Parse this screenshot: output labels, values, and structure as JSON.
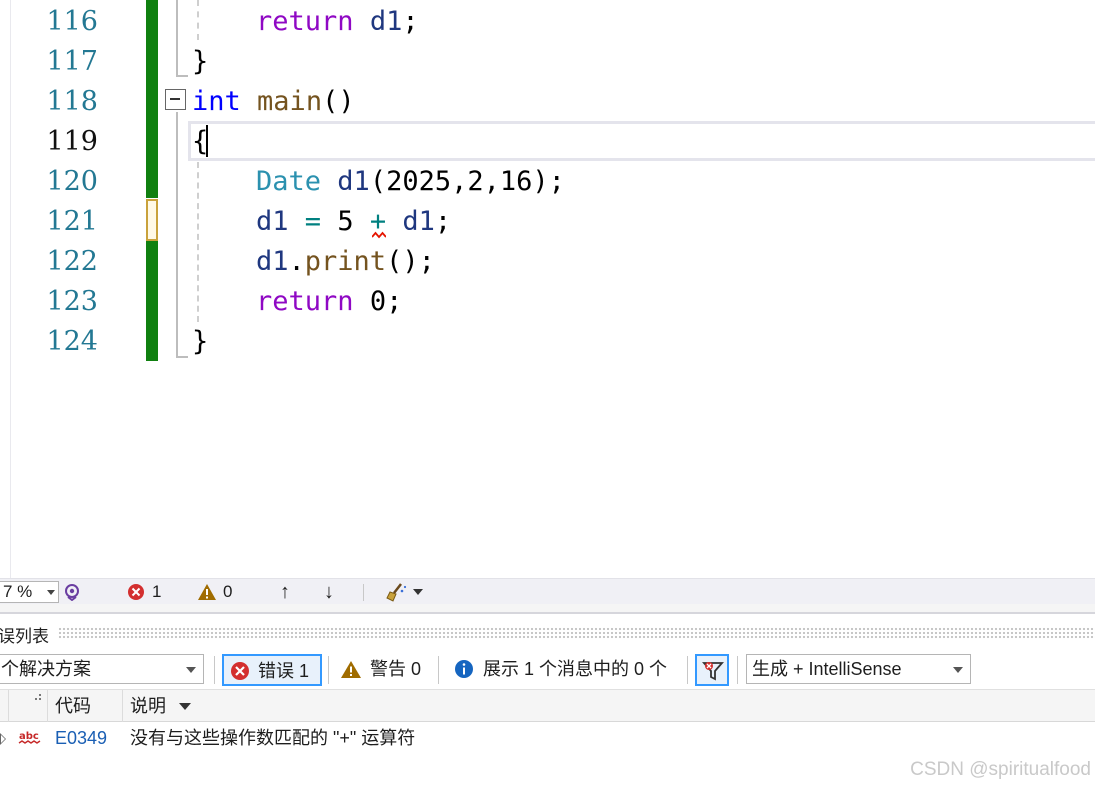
{
  "editor": {
    "line_numbers": [
      "116",
      "117",
      "118",
      "119",
      "120",
      "121",
      "122",
      "123",
      "124"
    ],
    "current_line": "119",
    "lines": {
      "l116": {
        "kw": "return",
        "sp": " ",
        "var": "d1",
        "end": ";"
      },
      "l117": {
        "brace": "}"
      },
      "l118": {
        "kw": "int",
        "sp": " ",
        "fn": "main",
        "paren": "()"
      },
      "l119": {
        "brace": "{"
      },
      "l120": {
        "type": "Date",
        "sp": " ",
        "fn": "d1",
        "args": "(2025,2,16);"
      },
      "l121": {
        "var1": "d1",
        "sp1": " ",
        "op1": "=",
        "sp2": " ",
        "num": "5",
        "sp3": " ",
        "op2": "+",
        "sp4": " ",
        "var2": "d1",
        "end": ";"
      },
      "l122": {
        "var": "d1",
        "dot": ".",
        "fn": "print",
        "end": "();"
      },
      "l123": {
        "kw": "return",
        "sp": " ",
        "num": "0",
        "end": ";"
      },
      "l124": {
        "brace": "}"
      }
    }
  },
  "status_bar": {
    "zoom": "7 %",
    "error_count": "1",
    "warning_count": "0",
    "up_arrow": "↑",
    "down_arrow": "↓"
  },
  "error_list": {
    "title": "误列表",
    "scope": "个解决方案",
    "errors_button": "错误 1",
    "warnings_button": "警告 0",
    "messages_button": "展示 1 个消息中的 0 个",
    "build_filter": "生成 + IntelliSense",
    "columns": {
      "code": "代码",
      "description": "说明"
    },
    "rows": [
      {
        "icon": "spelling-icon",
        "code": "E0349",
        "description": "没有与这些操作数匹配的 \"+\" 运算符"
      }
    ]
  },
  "watermark": "CSDN @spiritualfood",
  "colors": {
    "change_saved": "#108010",
    "keyword": "#0000ff",
    "control_keyword": "#8f08c4",
    "type": "#2b91af",
    "error_red": "#d32f2f",
    "warning_amber": "#a06c00",
    "info_blue": "#1565c0"
  }
}
